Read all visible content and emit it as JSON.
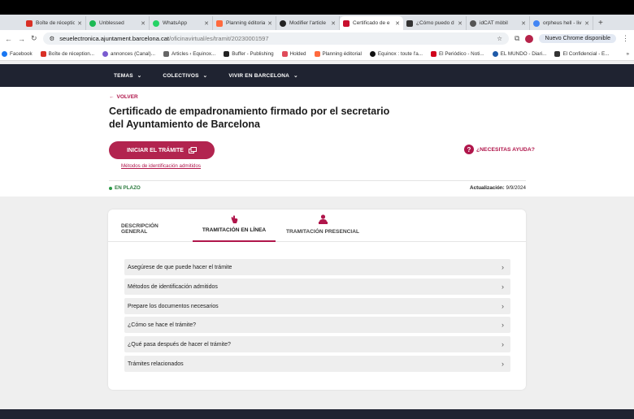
{
  "browser": {
    "tabs": [
      {
        "label": "Boîte de réception",
        "color": "#d93025",
        "active": false
      },
      {
        "label": "Unblessed",
        "color": "#1db954",
        "active": false
      },
      {
        "label": "WhatsApp",
        "color": "#25d366",
        "active": false
      },
      {
        "label": "Planning éditorial",
        "color": "#ff6a3d",
        "active": false
      },
      {
        "label": "Modifier l'article",
        "color": "#222222",
        "active": false
      },
      {
        "label": "Certificado de e",
        "color": "#c8102e",
        "active": true
      },
      {
        "label": "¿Cómo puedo d",
        "color": "#333333",
        "active": false
      },
      {
        "label": "idCAT mòbil",
        "color": "#555555",
        "active": false
      },
      {
        "label": "orpheus hell - liv",
        "color": "#4285f4",
        "active": false
      }
    ],
    "url_host": "seuelectronica.ajuntament.barcelona.cat",
    "url_path": "/oficinavirtual/es/tramit/20230001597",
    "profile_button": "Nuevo Chrome disponible",
    "bookmarks": [
      {
        "label": "Facebook",
        "color": "#1877f2"
      },
      {
        "label": "Boîte de réception...",
        "color": "#d93025"
      },
      {
        "label": "annonces (Canal)...",
        "color": "#7a5cd0"
      },
      {
        "label": "Articles ‹ Equinox...",
        "color": "#666666"
      },
      {
        "label": "Buffer - Publishing",
        "color": "#222222"
      },
      {
        "label": "Holded",
        "color": "#e04b5a"
      },
      {
        "label": "Planning éditorial",
        "color": "#ff6a3d"
      },
      {
        "label": "Equinox : toute l'a...",
        "color": "#111111"
      },
      {
        "label": "El Periódico - Noti...",
        "color": "#d0021b"
      },
      {
        "label": "EL MUNDO - Diari...",
        "color": "#1e5aa8"
      },
      {
        "label": "El Confidencial - E...",
        "color": "#333333"
      }
    ]
  },
  "site": {
    "nav": [
      "TEMAS",
      "COLECTIVOS",
      "VIVIR EN BARCELONA"
    ],
    "back_label": "VOLVER",
    "title": "Certificado de empadronamiento firmado por el secretario del Ayuntamiento de Barcelona",
    "start_button": "INICIAR EL TRÁMITE",
    "ident_link": "Métodos de identificación admitidos",
    "help_label": "¿NECESITAS AYUDA?",
    "status": "EN PLAZO",
    "update_label": "Actualización:",
    "update_date": "9/9/2024",
    "tabs": [
      {
        "label": "DESCRIPCIÓN GENERAL",
        "selected": false
      },
      {
        "label": "TRAMITACIÓN EN LÍNEA",
        "selected": true
      },
      {
        "label": "TRAMITACIÓN PRESENCIAL",
        "selected": false
      }
    ],
    "accordion": [
      "Asegúrese de que puede hacer el trámite",
      "Métodos de identificación admitidos",
      "Prepare los documentos necesarios",
      "¿Cómo se hace el trámite?",
      "¿Qué pasa después de hacer el trámite?",
      "Trámites relacionados"
    ],
    "accent": "#b0164b"
  }
}
